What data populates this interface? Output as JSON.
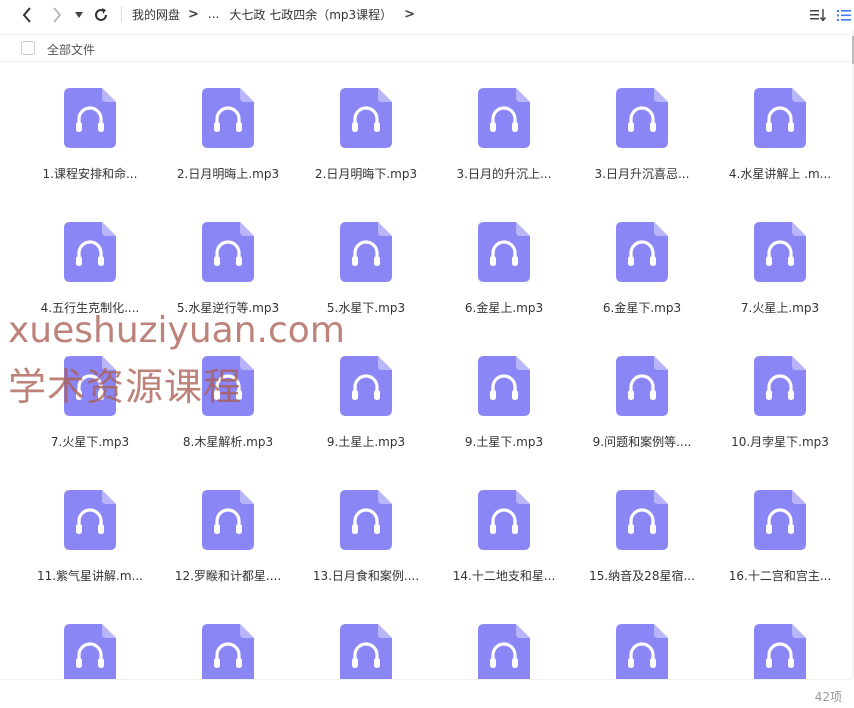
{
  "toolbar": {
    "back_icon": "chevron-left-icon",
    "forward_icon": "chevron-right-icon",
    "history_icon": "caret-down-icon",
    "refresh_icon": "refresh-icon",
    "breadcrumb": {
      "root": "我的网盘",
      "ellipsis": "...",
      "current": "大七政 七政四余（mp3课程）"
    },
    "sort_icon": "sort-icon",
    "list_view_icon": "list-view-icon"
  },
  "subbar": {
    "select_all_label": "全部文件"
  },
  "files": [
    {
      "name": "1.课程安排和命..."
    },
    {
      "name": "2.日月明晦上.mp3"
    },
    {
      "name": "2.日月明晦下.mp3"
    },
    {
      "name": "3.日月的升沉上..."
    },
    {
      "name": "3.日月升沉喜忌..."
    },
    {
      "name": "4.水星讲解上 .m..."
    },
    {
      "name": "4.五行生克制化...."
    },
    {
      "name": "5.水星逆行等.mp3"
    },
    {
      "name": "5.水星下.mp3"
    },
    {
      "name": "6.金星上.mp3"
    },
    {
      "name": "6.金星下.mp3"
    },
    {
      "name": "7.火星上.mp3"
    },
    {
      "name": "7.火星下.mp3"
    },
    {
      "name": "8.木星解析.mp3"
    },
    {
      "name": "9.土星上.mp3"
    },
    {
      "name": "9.土星下.mp3"
    },
    {
      "name": "9.问题和案例等...."
    },
    {
      "name": "10.月孛星下.mp3"
    },
    {
      "name": "11.紫气星讲解.m..."
    },
    {
      "name": "12.罗睺和计都星...."
    },
    {
      "name": "13.日月食和案例...."
    },
    {
      "name": "14.十二地支和星..."
    },
    {
      "name": "15.纳音及28星宿..."
    },
    {
      "name": "16.十二宫和宫主..."
    },
    {
      "name": ""
    },
    {
      "name": ""
    },
    {
      "name": ""
    },
    {
      "name": ""
    },
    {
      "name": ""
    },
    {
      "name": ""
    }
  ],
  "file_icon": "audio-file-icon",
  "footer": {
    "item_count": "42项"
  },
  "watermark": {
    "line1": "xueshuziyuan.com",
    "line2": "学术资源课程"
  },
  "colors": {
    "icon_fill": "#8a86f5",
    "icon_fold": "#b8b5fa",
    "accent": "#3e7bfa",
    "watermark": "#b0665e"
  }
}
